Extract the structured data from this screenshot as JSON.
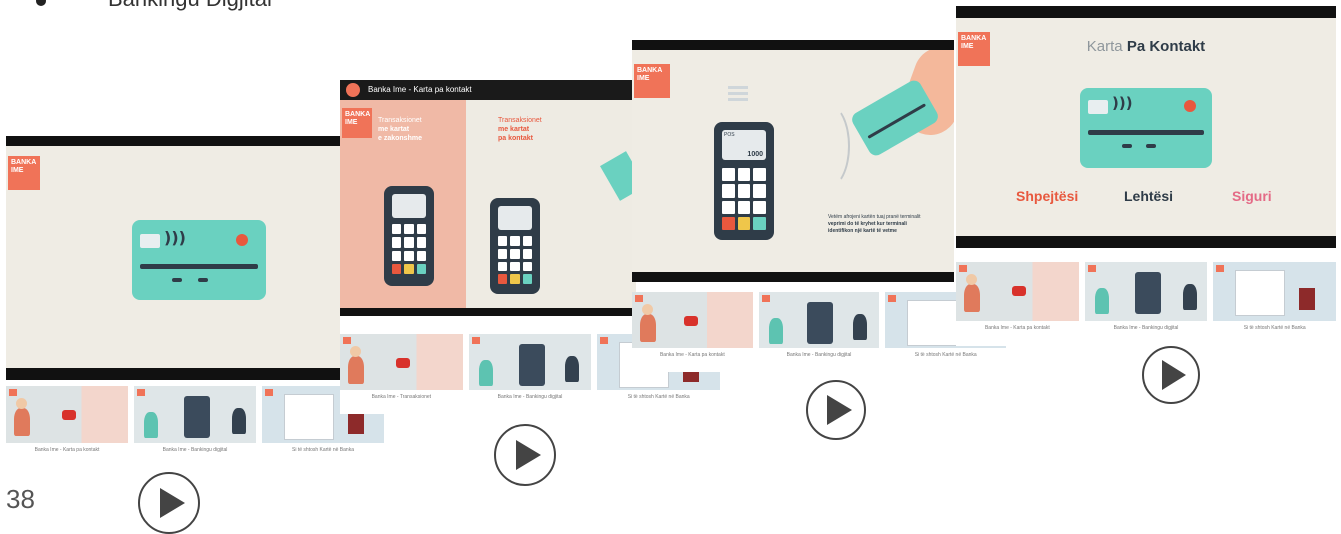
{
  "slide": {
    "heading": "Bankingu Digjital",
    "page_number": "38"
  },
  "videos": [
    {
      "logo_text": "BANKA IME",
      "captions": [
        "Banka Ime - Karta pa kontakt",
        "Banka Ime - Bankingu digjital",
        "Si të shtosh Kartë në Banka"
      ]
    },
    {
      "top_title": "Banka Ime - Karta pa kontakt",
      "logo_text": "BANKA IME",
      "left_label": [
        "Transaksionet",
        "me kartat",
        "e zakonshme"
      ],
      "right_label": [
        "Transaksionet",
        "me kartat",
        "pa kontakt"
      ],
      "captions": [
        "Banka Ime - Transaksionet",
        "Banka Ime - Bankingu digjital",
        "Si të shtosh Kartë në Banka"
      ]
    },
    {
      "logo_text": "BANKA IME",
      "terminal_amount": "1000",
      "terminal_label": "POS",
      "side_text": [
        "Vetëm afrojeni kartën tuaj pranë terminalit",
        "veprimi do të kryhet kur terminali",
        "identifikon një kartë të vetme"
      ],
      "captions": [
        "Banka Ime - Karta pa kontakt",
        "Banka Ime - Bankingu digjital",
        "Si të shtosh Kartë në Banka"
      ]
    },
    {
      "logo_text": "BANKA IME",
      "title_light": "Karta",
      "title_bold": "Pa Kontakt",
      "features": [
        "Shpejtësi",
        "Lehtësi",
        "Siguri"
      ],
      "captions": [
        "Banka Ime - Karta pa kontakt",
        "Banka Ime - Bankingu digjital",
        "Si të shtosh Kartë në Banka"
      ]
    }
  ],
  "colors": {
    "accent": "#f07358",
    "card": "#6ad1c0",
    "dark": "#2f3c48",
    "feature_red": "#e8583e",
    "feature_pink": "#e46a86"
  }
}
